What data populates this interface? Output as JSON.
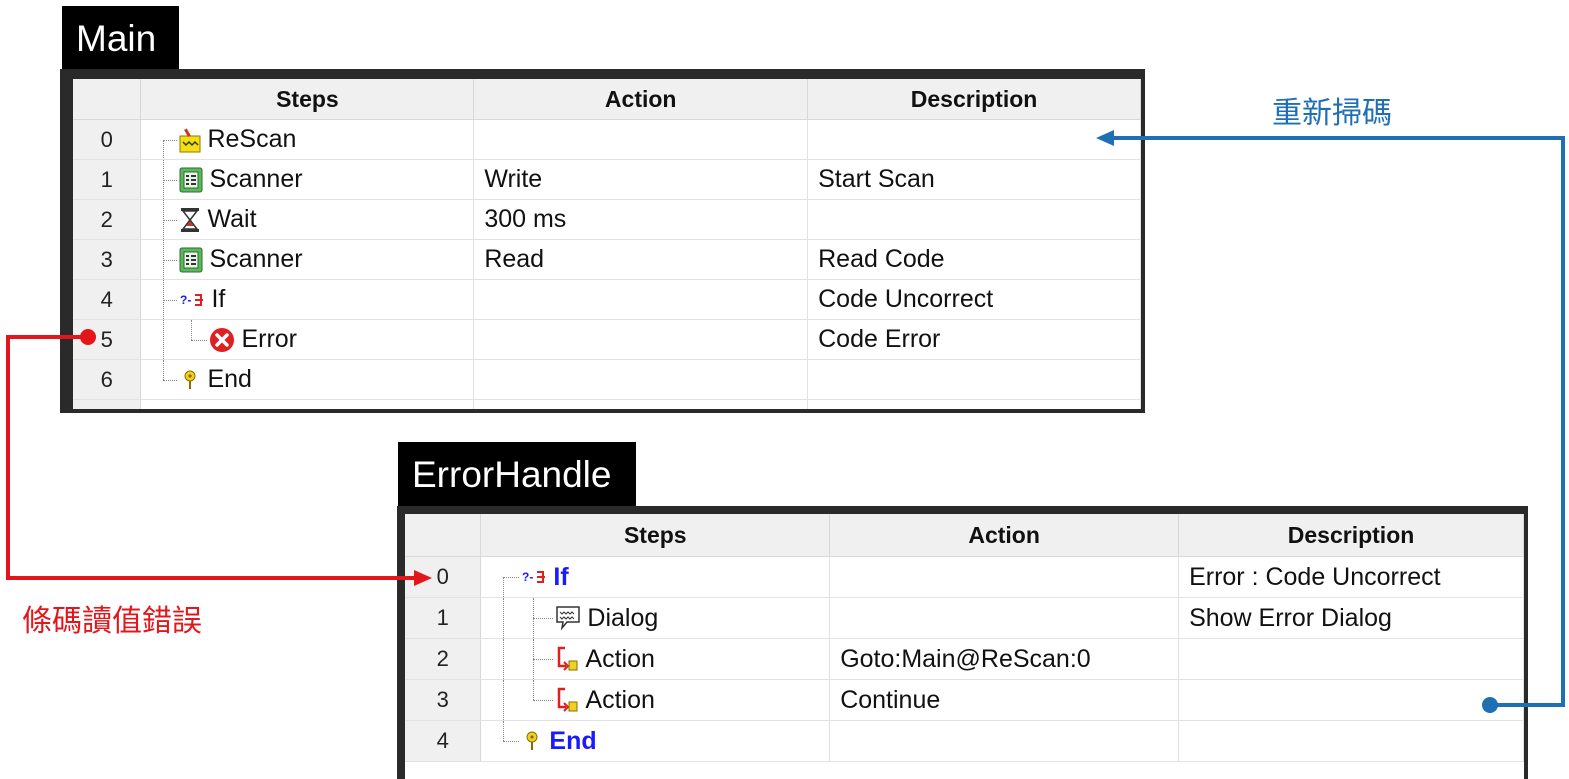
{
  "main": {
    "tab_title": "Main",
    "headers": {
      "steps": "Steps",
      "action": "Action",
      "description": "Description"
    },
    "rows": [
      {
        "num": "0",
        "step": "ReScan",
        "icon": "rescan-icon",
        "action": "",
        "description": ""
      },
      {
        "num": "1",
        "step": "Scanner",
        "icon": "scanner-icon",
        "action": "Write",
        "description": "Start Scan"
      },
      {
        "num": "2",
        "step": "Wait",
        "icon": "hourglass-icon",
        "action": "300 ms",
        "description": ""
      },
      {
        "num": "3",
        "step": "Scanner",
        "icon": "scanner-icon",
        "action": "Read",
        "description": "Read Code"
      },
      {
        "num": "4",
        "step": "If",
        "icon": "if-branch-icon",
        "action": "",
        "description": "Code Uncorrect"
      },
      {
        "num": "5",
        "step": "Error",
        "icon": "error-icon",
        "action": "",
        "description": "Code Error"
      },
      {
        "num": "6",
        "step": "End",
        "icon": "end-pin-icon",
        "action": "",
        "description": ""
      }
    ]
  },
  "error_handle": {
    "tab_title": "ErrorHandle",
    "headers": {
      "steps": "Steps",
      "action": "Action",
      "description": "Description"
    },
    "rows": [
      {
        "num": "0",
        "step": "If",
        "icon": "if-branch-icon",
        "action": "",
        "description": "Error : Code Uncorrect"
      },
      {
        "num": "1",
        "step": "Dialog",
        "icon": "dialog-icon",
        "action": "",
        "description": "Show Error Dialog"
      },
      {
        "num": "2",
        "step": "Action",
        "icon": "action-icon",
        "action": "Goto:Main@ReScan:0",
        "description": ""
      },
      {
        "num": "3",
        "step": "Action",
        "icon": "action-icon",
        "action": "Continue",
        "description": ""
      },
      {
        "num": "4",
        "step": "End",
        "icon": "end-pin-icon",
        "action": "",
        "description": ""
      }
    ]
  },
  "annotations": {
    "rescan_label": "重新掃碼",
    "error_label": "條碼讀值錯誤",
    "rescan_color": "#1f6fb4",
    "error_color": "#e3171b"
  }
}
